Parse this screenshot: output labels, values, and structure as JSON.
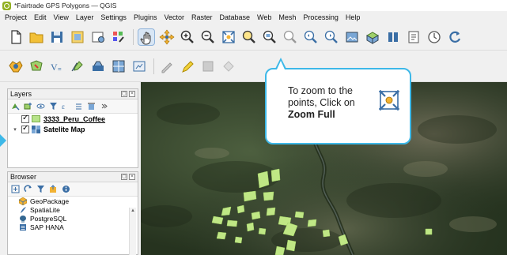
{
  "window": {
    "title": "*Fairtrade GPS Polygons — QGIS"
  },
  "menubar": {
    "items": [
      "Project",
      "Edit",
      "View",
      "Layer",
      "Settings",
      "Plugins",
      "Vector",
      "Raster",
      "Database",
      "Web",
      "Mesh",
      "Processing",
      "Help"
    ]
  },
  "layers_panel": {
    "title": "Layers",
    "layers": [
      {
        "name": "3333_Peru_Coffee",
        "checked": true,
        "type": "vector-polygon"
      },
      {
        "name": "Satelite Map",
        "checked": true,
        "type": "raster",
        "expanded": true
      }
    ]
  },
  "browser_panel": {
    "title": "Browser",
    "items": [
      "GeoPackage",
      "SpatiaLite",
      "PostgreSQL",
      "SAP HANA"
    ]
  },
  "callout": {
    "line1": "To zoom to the",
    "line2": "points, Click on",
    "bold": "Zoom Full"
  },
  "colors": {
    "accent": "#3db8e8",
    "polygon_fill": "#c7f08a",
    "qgis_green": "#93b023"
  }
}
